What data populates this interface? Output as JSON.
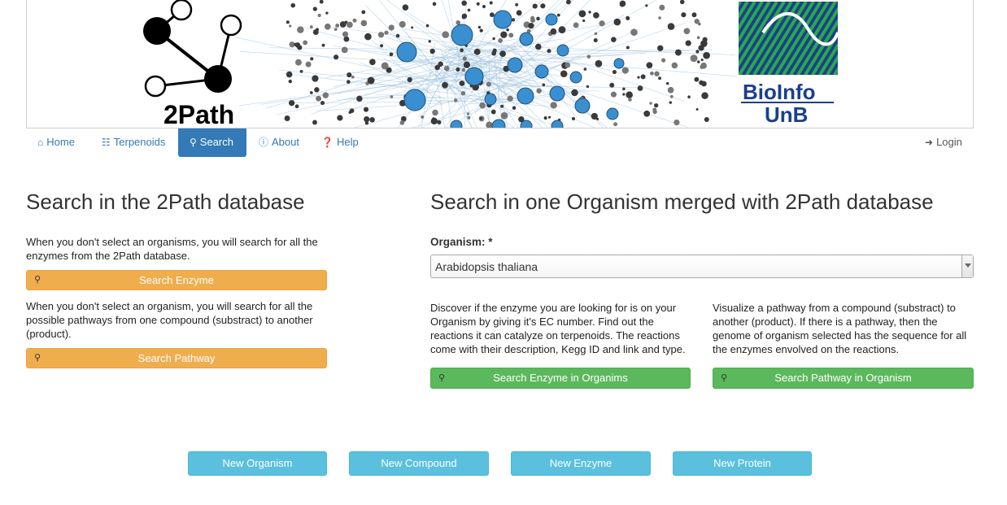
{
  "banner": {
    "logo_left_text": "2Path",
    "logo_right_line1": "BioInfo",
    "logo_right_line2": "UnB"
  },
  "nav": {
    "items": [
      {
        "label": "Home",
        "icon": "home-icon"
      },
      {
        "label": "Terpenoids",
        "icon": "sitemap-icon"
      },
      {
        "label": "Search",
        "icon": "search-icon",
        "active": true
      },
      {
        "label": "About",
        "icon": "info-icon"
      },
      {
        "label": "Help",
        "icon": "question-icon"
      }
    ],
    "login": {
      "label": "Login",
      "icon": "sign-in-icon"
    }
  },
  "left": {
    "title": "Search in the 2Path database",
    "enzyme_text": "When you don't select an organisms, you will search for all the enzymes from the 2Path database.",
    "enzyme_button": "Search Enzyme",
    "pathway_text": "When you don't select an organism, you will search for all the possible pathways from one compound (substract) to another (product).",
    "pathway_button": "Search Pathway"
  },
  "right": {
    "title": "Search in one Organism merged with 2Path database",
    "organism_label": "Organism:",
    "required_mark": "*",
    "organism_value": "Arabidopsis thaliana",
    "enzyme_text": "Discover if the enzyme you are looking for is on your Organism by giving it's EC number. Find out the reactions it can catalyze on terpenoids. The reactions come with their description, Kegg ID and link and type.",
    "enzyme_button": "Search Enzyme in Organims",
    "pathway_text": "Visualize a pathway from a compound (substract) to another (product). If there is a pathway, then the genome of organism selected has the sequence for all the enzymes envolved on the reactions.",
    "pathway_button": "Search Pathway in Organism"
  },
  "bottom_buttons": [
    "New Organism",
    "New Compound",
    "New Enzyme",
    "New Protein"
  ],
  "colors": {
    "primary": "#337ab7",
    "warning": "#f0ad4e",
    "success": "#5cb85c",
    "info": "#5bc0de",
    "network_blue": "#3a8fd0",
    "logo_green": "#2aa84a",
    "logo_navy": "#1b3f8f"
  }
}
